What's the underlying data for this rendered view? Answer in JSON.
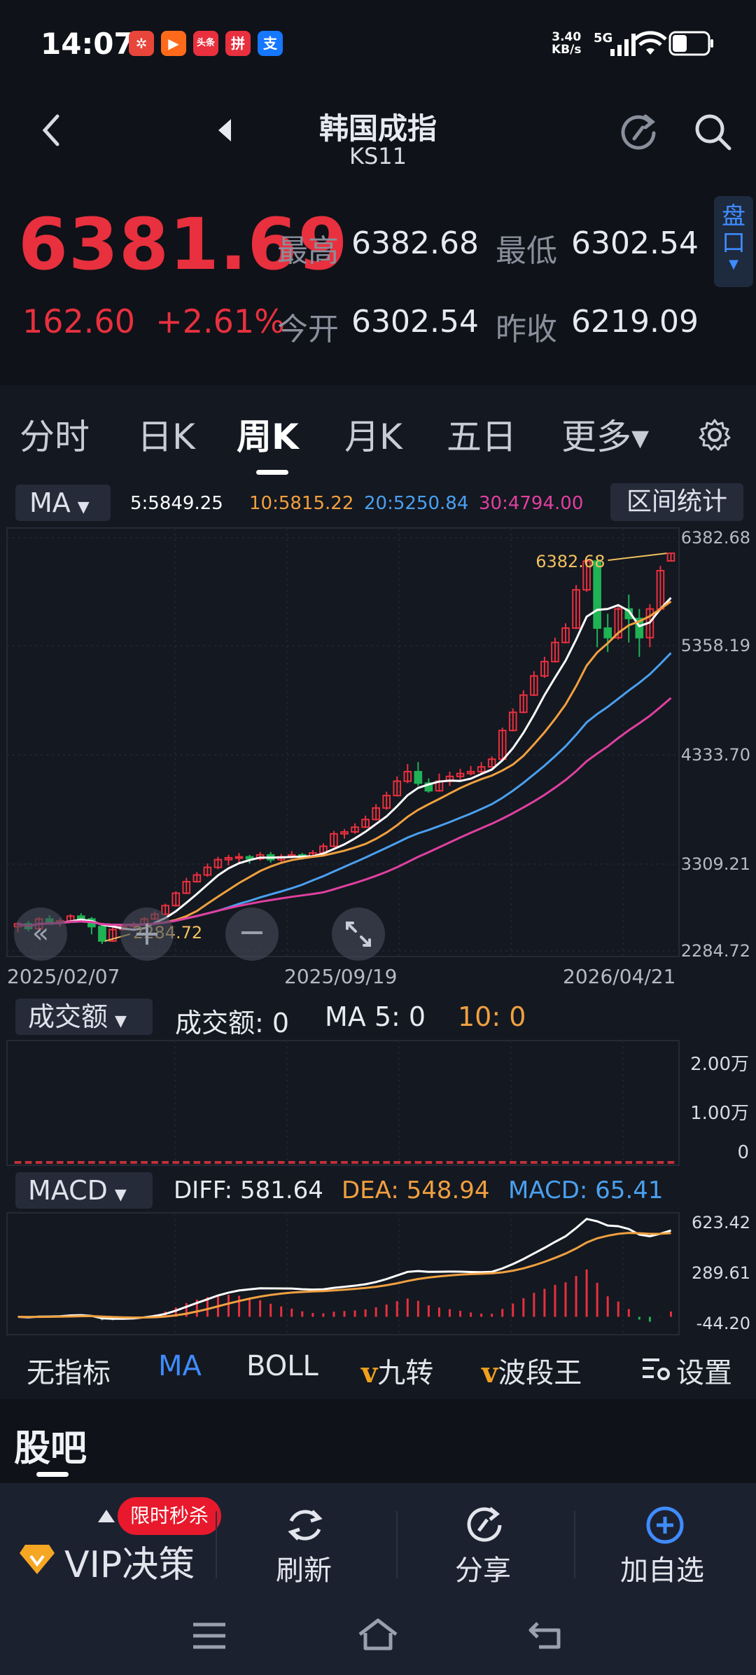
{
  "status": {
    "time": "14:07",
    "net_speed": "3.40",
    "net_unit": "KB/s",
    "network": "5G",
    "apps": [
      {
        "icon": "weibo-icon",
        "color": "#e8463a",
        "text": "✲"
      },
      {
        "icon": "video-icon",
        "color": "#ff6a1a",
        "text": "▶"
      },
      {
        "icon": "toutiao-icon",
        "color": "#e8303e",
        "text": "头条"
      },
      {
        "icon": "pinduoduo-icon",
        "color": "#e8303e",
        "text": "拼"
      },
      {
        "icon": "alipay-icon",
        "color": "#1677ff",
        "text": "支"
      }
    ]
  },
  "header": {
    "title": "韩国成指",
    "code": "KS11",
    "back_icon": "back-icon",
    "refresh_icon": "refresh-icon",
    "search_icon": "search-icon"
  },
  "quote": {
    "price": "6381.69",
    "change": "162.60",
    "change_pct": "+2.61%",
    "high_label": "最高",
    "high": "6382.68",
    "low_label": "最低",
    "low": "6302.54",
    "open_label": "今开",
    "open": "6302.54",
    "prev_label": "昨收",
    "prev": "6219.09",
    "pan_label": "盘口",
    "up_color": "#e8303e",
    "down_color": "#1fb355"
  },
  "tabs": [
    {
      "label": "分时"
    },
    {
      "label": "日K"
    },
    {
      "label": "周K",
      "active": true
    },
    {
      "label": "月K"
    },
    {
      "label": "五日"
    },
    {
      "label": "更多▾"
    }
  ],
  "kline": {
    "indicator": "MA",
    "ma_values": [
      {
        "label": "5:5849.25",
        "color": "#ffffff"
      },
      {
        "label": "10:5815.22",
        "color": "#f0a040"
      },
      {
        "label": "20:5250.84",
        "color": "#4aa0f0"
      },
      {
        "label": "30:4794.00",
        "color": "#e040a0"
      }
    ],
    "range_stats": "区间统计",
    "y_ticks": [
      "6382.68",
      "5358.19",
      "4333.70",
      "3309.21",
      "2284.72"
    ],
    "x_ticks": [
      "2025/02/07",
      "2025/09/19",
      "2026/04/21"
    ],
    "high_mark": "6382.68",
    "low_mark": "2284.72"
  },
  "volume": {
    "indicator": "成交额",
    "summary": "成交额: 0",
    "ma5": "MA 5: 0",
    "ma10": "10: 0",
    "y_ticks": [
      "2.00万",
      "1.00万",
      "0"
    ]
  },
  "macd": {
    "indicator": "MACD",
    "diff": "DIFF: 581.64",
    "dea": "DEA: 548.94",
    "macd": "MACD: 65.41",
    "y_ticks": [
      "623.42",
      "289.61",
      "-44.20"
    ]
  },
  "indicator_bar": [
    {
      "label": "无指标"
    },
    {
      "label": "MA",
      "active": true
    },
    {
      "label": "BOLL"
    },
    {
      "label": "九转",
      "prefix": "v"
    },
    {
      "label": "波段王",
      "prefix": "v"
    },
    {
      "label": "设置",
      "icon": "settings-list-icon"
    }
  ],
  "guba": {
    "title": "股吧"
  },
  "footer": {
    "vip": "VIP决策",
    "vip_badge": "限时秒杀",
    "refresh": "刷新",
    "share": "分享",
    "add": "加自选"
  },
  "chart_data": {
    "type": "candlestick",
    "title": "韩国成指 KS11 周K",
    "x_start": "2025/02/07",
    "x_mid": "2025/09/19",
    "x_end": "2026/04/21",
    "ylim": [
      2284.72,
      6382.68
    ],
    "candles": [
      [
        2480,
        2510,
        2420,
        2530
      ],
      [
        2510,
        2460,
        2430,
        2540
      ],
      [
        2460,
        2560,
        2450,
        2580
      ],
      [
        2560,
        2520,
        2500,
        2600
      ],
      [
        2520,
        2540,
        2480,
        2570
      ],
      [
        2540,
        2590,
        2520,
        2610
      ],
      [
        2590,
        2560,
        2540,
        2620
      ],
      [
        2560,
        2480,
        2400,
        2580
      ],
      [
        2480,
        2330,
        2300,
        2500
      ],
      [
        2330,
        2450,
        2320,
        2470
      ],
      [
        2450,
        2480,
        2440,
        2500
      ],
      [
        2480,
        2500,
        2460,
        2530
      ],
      [
        2500,
        2560,
        2490,
        2580
      ],
      [
        2560,
        2610,
        2550,
        2640
      ],
      [
        2610,
        2700,
        2600,
        2720
      ],
      [
        2700,
        2830,
        2690,
        2850
      ],
      [
        2830,
        2950,
        2820,
        2990
      ],
      [
        2950,
        3020,
        2940,
        3050
      ],
      [
        3020,
        3100,
        3000,
        3140
      ],
      [
        3100,
        3180,
        3080,
        3210
      ],
      [
        3180,
        3200,
        3120,
        3230
      ],
      [
        3200,
        3210,
        3150,
        3250
      ],
      [
        3210,
        3190,
        3140,
        3230
      ],
      [
        3190,
        3230,
        3170,
        3260
      ],
      [
        3230,
        3180,
        3150,
        3260
      ],
      [
        3180,
        3210,
        3160,
        3240
      ],
      [
        3210,
        3230,
        3190,
        3270
      ],
      [
        3230,
        3210,
        3180,
        3250
      ],
      [
        3210,
        3250,
        3200,
        3280
      ],
      [
        3250,
        3320,
        3240,
        3350
      ],
      [
        3320,
        3450,
        3310,
        3480
      ],
      [
        3450,
        3470,
        3400,
        3500
      ],
      [
        3470,
        3520,
        3450,
        3560
      ],
      [
        3520,
        3600,
        3510,
        3640
      ],
      [
        3600,
        3720,
        3590,
        3760
      ],
      [
        3720,
        3850,
        3700,
        3890
      ],
      [
        3850,
        4000,
        3840,
        4050
      ],
      [
        4000,
        4100,
        3980,
        4180
      ],
      [
        4100,
        3980,
        3950,
        4200
      ],
      [
        3980,
        3900,
        3880,
        4030
      ],
      [
        3900,
        4000,
        3890,
        4080
      ],
      [
        4000,
        4050,
        3950,
        4100
      ],
      [
        4050,
        4080,
        4000,
        4130
      ],
      [
        4080,
        4100,
        4060,
        4160
      ],
      [
        4100,
        4150,
        4080,
        4200
      ],
      [
        4150,
        4230,
        4140,
        4260
      ],
      [
        4230,
        4530,
        4220,
        4560
      ],
      [
        4530,
        4720,
        4520,
        4760
      ],
      [
        4720,
        4900,
        4710,
        4950
      ],
      [
        4900,
        5100,
        4890,
        5150
      ],
      [
        5100,
        5250,
        5080,
        5300
      ],
      [
        5250,
        5450,
        5240,
        5500
      ],
      [
        5450,
        5600,
        5440,
        5650
      ],
      [
        5600,
        6000,
        5590,
        6050
      ],
      [
        6000,
        6300,
        5980,
        6330
      ],
      [
        6300,
        5600,
        5400,
        6350
      ],
      [
        5600,
        5500,
        5350,
        5750
      ],
      [
        5500,
        5800,
        5480,
        5850
      ],
      [
        5800,
        5700,
        5450,
        5950
      ],
      [
        5700,
        5500,
        5300,
        5800
      ],
      [
        5500,
        5800,
        5400,
        5850
      ],
      [
        5800,
        6200,
        5780,
        6250
      ],
      [
        6302,
        6382,
        6302,
        6383
      ]
    ],
    "ma_note": "MA5 / MA10 / MA20 / MA30 computed from closes",
    "macd_series": "DIFF and DEA lines with histogram"
  }
}
